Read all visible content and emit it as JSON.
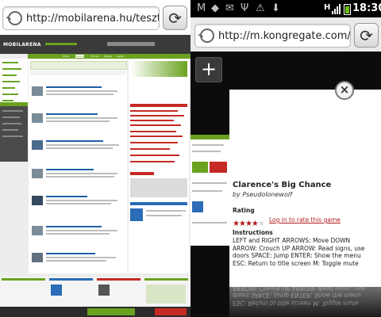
{
  "left_tab": {
    "url": "http://mobilarena.hu/tesztek/ind...",
    "site_logo": "MOBILARENA",
    "nav_items": [
      "Hírek",
      "Tesztek",
      "Fórum",
      "Blogok",
      "Aprók"
    ]
  },
  "right_tab": {
    "url": "http://m.kongregate.com/games...",
    "new_tab_label": "+",
    "game": {
      "title": "Clarence's Big Chance",
      "author": "by Pseudolonewolf",
      "rating_label": "Rating",
      "rating_stars": 4,
      "rating_max": 5,
      "rate_link": "Log in to rate this game",
      "instructions_label": "Instructions",
      "instructions": [
        "LEFT and RIGHT ARROWS: Move DOWN",
        "ARROW: Crouch UP ARROW: Read signs, use",
        "doors SPACE: Jump ENTER: Show the menu",
        "ESC: Return to title screen M: Toggle mute"
      ]
    }
  },
  "status_bar": {
    "time": "18:30",
    "network": "H",
    "icons": [
      "gmail-icon",
      "stack-icon",
      "email-icon",
      "usb-icon",
      "warning-icon",
      "download-icon",
      "signal-icon",
      "battery-icon"
    ]
  },
  "colors": {
    "accent_green": "#6aa220",
    "status_bg": "#000000",
    "link_red": "#b01c1c"
  }
}
